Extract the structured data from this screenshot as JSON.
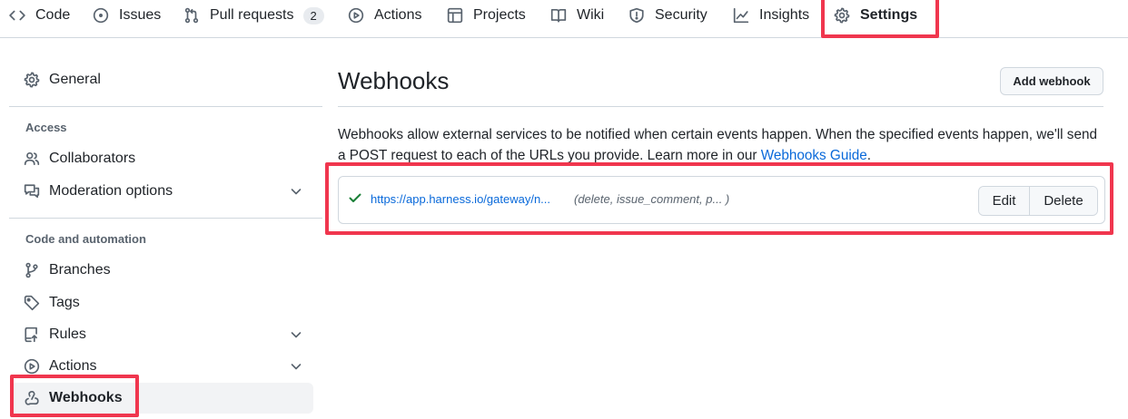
{
  "nav": {
    "tabs": [
      {
        "label": "Code",
        "icon": "code-icon"
      },
      {
        "label": "Issues",
        "icon": "issue-opened-icon"
      },
      {
        "label": "Pull requests",
        "icon": "git-pull-request-icon",
        "count": "2"
      },
      {
        "label": "Actions",
        "icon": "play-icon"
      },
      {
        "label": "Projects",
        "icon": "table-icon"
      },
      {
        "label": "Wiki",
        "icon": "book-icon"
      },
      {
        "label": "Security",
        "icon": "shield-icon"
      },
      {
        "label": "Insights",
        "icon": "graph-icon"
      },
      {
        "label": "Settings",
        "icon": "gear-icon",
        "selected": true
      }
    ]
  },
  "sidebar": {
    "general": "General",
    "access_heading": "Access",
    "collaborators": "Collaborators",
    "moderation": "Moderation options",
    "code_heading": "Code and automation",
    "branches": "Branches",
    "tags": "Tags",
    "rules": "Rules",
    "actions": "Actions",
    "webhooks": "Webhooks"
  },
  "main": {
    "title": "Webhooks",
    "add_button": "Add webhook",
    "description": "Webhooks allow external services to be notified when certain events happen. When the specified events happen, we'll send a POST request to each of the URLs you provide. Learn more in our ",
    "guide_link": "Webhooks Guide",
    "description_end": ".",
    "webhook": {
      "url": "https://app.harness.io/gateway/n...",
      "events": "(delete, issue_comment, p...  )",
      "status": "active",
      "edit_label": "Edit",
      "delete_label": "Delete"
    }
  },
  "colors": {
    "highlight": "#f0364e",
    "link": "#0969da",
    "success": "#1a7f37"
  }
}
